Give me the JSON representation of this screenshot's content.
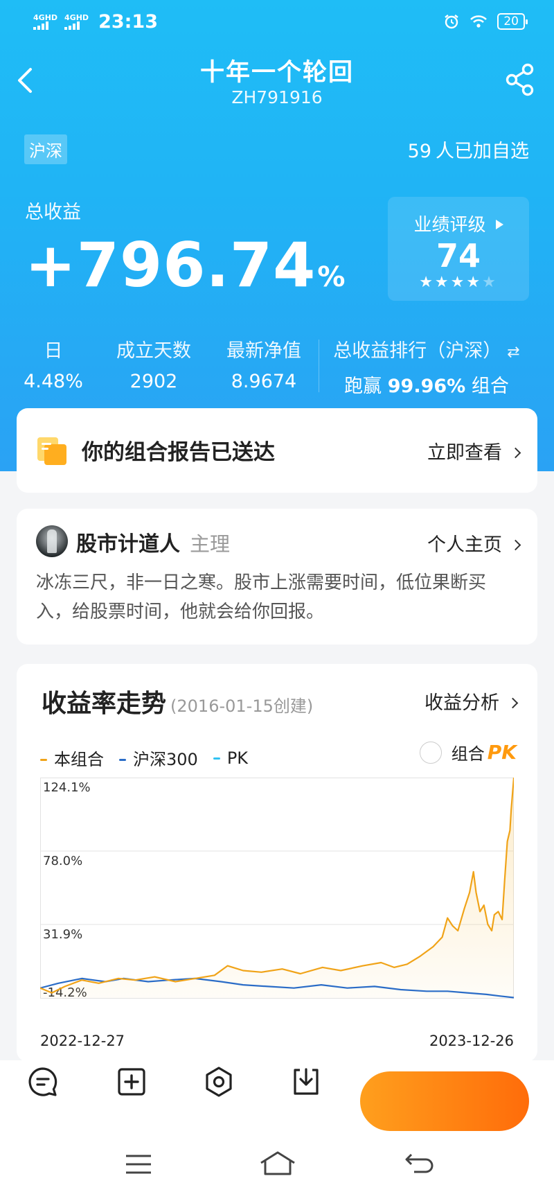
{
  "status_bar": {
    "signal1": "4G",
    "signal1_sup": "HD",
    "signal2": "4G",
    "signal2_sup": "HD",
    "time": "23:13",
    "battery": "20"
  },
  "header": {
    "title": "十年一个轮回",
    "code": "ZH791916"
  },
  "market_tag": "沪深",
  "followers": {
    "count": "59",
    "text": "人已加自选"
  },
  "total_return": {
    "label": "总收益",
    "value": "+796.74",
    "unit": "%"
  },
  "rating": {
    "label": "业绩评级",
    "score": "74",
    "stars": 4.5,
    "max_stars": 5
  },
  "stats": {
    "day": {
      "label": "日",
      "value": "4.48%"
    },
    "days_since": {
      "label": "成立天数",
      "value": "2902"
    },
    "nav": {
      "label": "最新净值",
      "value": "8.9674"
    },
    "rank": {
      "label": "总收益排行（沪深）",
      "prefix": "跑赢",
      "value": "99.96%",
      "suffix": "组合"
    }
  },
  "report": {
    "text": "你的组合报告已送达",
    "link": "立即查看"
  },
  "manager": {
    "name": "股市计道人",
    "role": "主理",
    "link": "个人主页",
    "description": "冰冻三尺，非一日之寒。股市上涨需要时间，低位果断买入，给股票时间，他就会给你回报。"
  },
  "trend": {
    "title": "收益率走势",
    "subtitle": "(2016-01-15创建)",
    "link": "收益分析",
    "legend": [
      {
        "name": "本组合",
        "color": "#f0a318"
      },
      {
        "name": "沪深300",
        "color": "#2a6cc7"
      },
      {
        "name": "PK",
        "color": "#31c2f2"
      }
    ],
    "pk_label": "组合",
    "pk_mark": "PK",
    "date_start": "2022-12-27",
    "date_end": "2023-12-26"
  },
  "chart_data": {
    "type": "line",
    "title": "收益率走势",
    "ylim": [
      -14.2,
      124.1
    ],
    "y_ticks": [
      "124.1%",
      "78.0%",
      "31.9%",
      "-14.2%"
    ],
    "x_range": [
      "2022-12-27",
      "2023-12-26"
    ],
    "grid": true,
    "series": [
      {
        "name": "本组合",
        "color": "#f0a318",
        "points": [
          [
            "2022-12-27",
            -8
          ],
          [
            "2023-01-05",
            -11
          ],
          [
            "2023-01-15",
            -7
          ],
          [
            "2023-01-28",
            -3
          ],
          [
            "2023-02-10",
            -5
          ],
          [
            "2023-02-25",
            -2
          ],
          [
            "2023-03-10",
            -3
          ],
          [
            "2023-03-25",
            -1
          ],
          [
            "2023-04-10",
            -4
          ],
          [
            "2023-04-25",
            -2
          ],
          [
            "2023-05-10",
            0
          ],
          [
            "2023-05-20",
            6
          ],
          [
            "2023-06-01",
            3
          ],
          [
            "2023-06-15",
            2
          ],
          [
            "2023-07-01",
            4
          ],
          [
            "2023-07-15",
            1
          ],
          [
            "2023-08-01",
            5
          ],
          [
            "2023-08-15",
            3
          ],
          [
            "2023-09-01",
            6
          ],
          [
            "2023-09-15",
            8
          ],
          [
            "2023-09-25",
            5
          ],
          [
            "2023-10-05",
            7
          ],
          [
            "2023-10-15",
            12
          ],
          [
            "2023-10-20",
            15
          ],
          [
            "2023-10-25",
            18
          ],
          [
            "2023-11-01",
            24
          ],
          [
            "2023-11-05",
            36
          ],
          [
            "2023-11-09",
            31
          ],
          [
            "2023-11-13",
            28
          ],
          [
            "2023-11-18",
            42
          ],
          [
            "2023-11-22",
            52
          ],
          [
            "2023-11-25",
            65
          ],
          [
            "2023-11-27",
            52
          ],
          [
            "2023-11-30",
            40
          ],
          [
            "2023-12-03",
            44
          ],
          [
            "2023-12-06",
            32
          ],
          [
            "2023-12-09",
            28
          ],
          [
            "2023-12-11",
            38
          ],
          [
            "2023-12-14",
            40
          ],
          [
            "2023-12-17",
            35
          ],
          [
            "2023-12-19",
            60
          ],
          [
            "2023-12-21",
            84
          ],
          [
            "2023-12-23",
            91
          ],
          [
            "2023-12-24",
            104
          ],
          [
            "2023-12-26",
            124.1
          ]
        ]
      },
      {
        "name": "沪深300",
        "color": "#2a6cc7",
        "points": [
          [
            "2022-12-27",
            -8
          ],
          [
            "2023-01-10",
            -5
          ],
          [
            "2023-01-28",
            -2
          ],
          [
            "2023-02-15",
            -4
          ],
          [
            "2023-03-01",
            -2
          ],
          [
            "2023-03-20",
            -4
          ],
          [
            "2023-04-05",
            -3
          ],
          [
            "2023-04-25",
            -2
          ],
          [
            "2023-05-15",
            -4
          ],
          [
            "2023-06-01",
            -6
          ],
          [
            "2023-06-20",
            -7
          ],
          [
            "2023-07-10",
            -8
          ],
          [
            "2023-07-31",
            -6
          ],
          [
            "2023-08-20",
            -8
          ],
          [
            "2023-09-10",
            -7
          ],
          [
            "2023-09-30",
            -9
          ],
          [
            "2023-10-20",
            -10
          ],
          [
            "2023-11-05",
            -10
          ],
          [
            "2023-11-20",
            -11
          ],
          [
            "2023-12-05",
            -12
          ],
          [
            "2023-12-15",
            -13
          ],
          [
            "2023-12-26",
            -14
          ]
        ]
      }
    ]
  }
}
